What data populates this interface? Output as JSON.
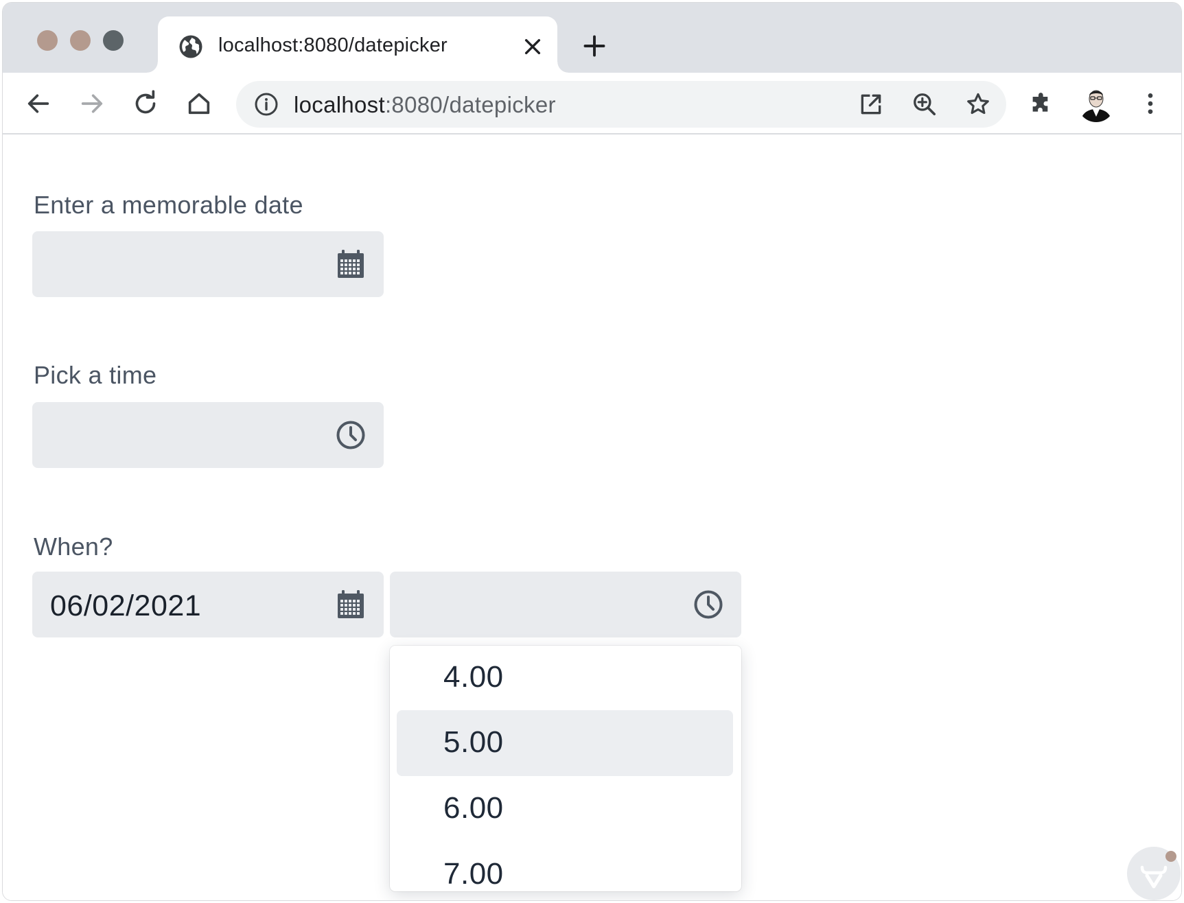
{
  "browser": {
    "tab": {
      "title": "localhost:8080/datepicker"
    },
    "address_bar": {
      "host": "localhost",
      "path": ":8080/datepicker"
    },
    "window_dot_colors": [
      "#b49a8e",
      "#b49a8e",
      "#5c6468"
    ]
  },
  "form": {
    "date_field": {
      "label": "Enter a memorable date",
      "value": "",
      "icon": "calendar-icon"
    },
    "time_field": {
      "label": "Pick a time",
      "value": "",
      "icon": "clock-icon"
    },
    "datetime_field": {
      "label": "When?",
      "date_value": "06/02/2021",
      "time_value": "",
      "date_icon": "calendar-icon",
      "time_icon": "clock-icon"
    }
  },
  "time_dropdown": {
    "options": [
      "4.00",
      "5.00",
      "6.00",
      "7.00"
    ],
    "highlighted": "5.00"
  },
  "colors": {
    "field_background": "#e9ebee",
    "highlight_background": "#eceef1",
    "badge_dot": "#b49a8e"
  }
}
